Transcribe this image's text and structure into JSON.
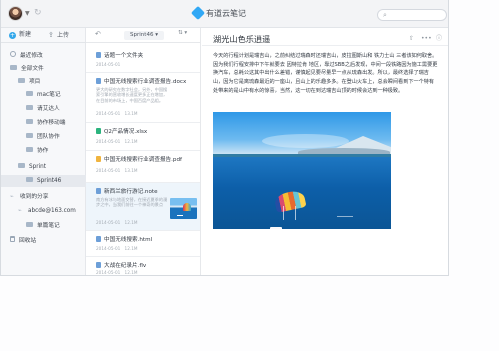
{
  "app": {
    "title": "有道云笔记",
    "search_placeholder": ""
  },
  "sidebar": {
    "new_label": "新建",
    "upload_label": "上传",
    "items": [
      {
        "label": "最近修改",
        "icon": "clock-icon"
      },
      {
        "label": "全部文件",
        "icon": "folder-icon"
      },
      {
        "label": "项目",
        "icon": "folder-icon"
      },
      {
        "label": "mac笔记",
        "icon": "folder-icon"
      },
      {
        "label": "请艾达人",
        "icon": "folder-icon"
      },
      {
        "label": "协作移动端",
        "icon": "folder-icon"
      },
      {
        "label": "团队协作",
        "icon": "folder-icon"
      },
      {
        "label": "协作",
        "icon": "folder-icon"
      },
      {
        "label": "Sprint",
        "icon": "folder-icon"
      },
      {
        "label": "Sprint46",
        "icon": "folder-icon"
      },
      {
        "label": "收到的分享",
        "icon": "share-icon"
      },
      {
        "label": "abcde@163.com",
        "icon": "share-icon"
      },
      {
        "label": "单篇笔记",
        "icon": "folder-icon"
      },
      {
        "label": "回收站",
        "icon": "trash-icon"
      }
    ]
  },
  "list": {
    "folder": "Sprint46",
    "notes": [
      {
        "title": "话题一个文件夹",
        "date": "2014-05-01",
        "size": "",
        "type": "doc"
      },
      {
        "title": "中国无线搜索行业调查报告.docx",
        "date": "2014-05-01",
        "size": "13.1M",
        "type": "doc",
        "snippet": "更大的研究在数字社会，另外，中国搜索引擎的营收增长速度更多正在增加，在目前的市场上，中国百度产品组。"
      },
      {
        "title": "Q2产品情况.xlsx",
        "date": "2014-05-01",
        "size": "12.1M",
        "type": "green"
      },
      {
        "title": "中国无线搜索行业调查报告.pdf",
        "date": "2014-05-01",
        "size": "13.1M",
        "type": "orange"
      },
      {
        "title": "新西兰旅行游记.note",
        "date": "2014-05-01",
        "size": "12.1M",
        "type": "doc",
        "snippet": "南方有冰与地面交替，在接近夏季的漫步之中，当我们前往一个神奇的景点"
      },
      {
        "title": "中国无线搜索.html",
        "date": "2014-05-01",
        "size": "12.1M",
        "type": "doc"
      },
      {
        "title": "大战在纪录片.flv",
        "date": "2014-05-01",
        "size": "12.1M",
        "type": "doc"
      }
    ]
  },
  "editor": {
    "title": "湖光山色乐逍遥",
    "body": "今天的行程计划是瑞吉山，之前纠结过瑞森时还瑞吉山，皮拉图斯山和 铁力士山 三者该如何取舍。因为我们行程安排中下午就要去 因特拉肯 地区，靠过SBB之后发现，中间一段铁路因为施工需要更换汽车，总耗公这其中出什么差错，谨慎起见要尽量早一点从琉森出发。所以，最终选择了瑞吉山，因为它是离琉森最近的一座山，且山上的乐趣多多。在登山火车上，总会瞬间看到下一个特有处带来的是山中有水的惊喜，当然，这一切在到达瑞吉山顶的时候会达到一种极致。"
  },
  "colors": {
    "accent": "#31a8f5",
    "selected_bg": "#e6e9ee",
    "active_note_bg": "#eef5fb"
  }
}
